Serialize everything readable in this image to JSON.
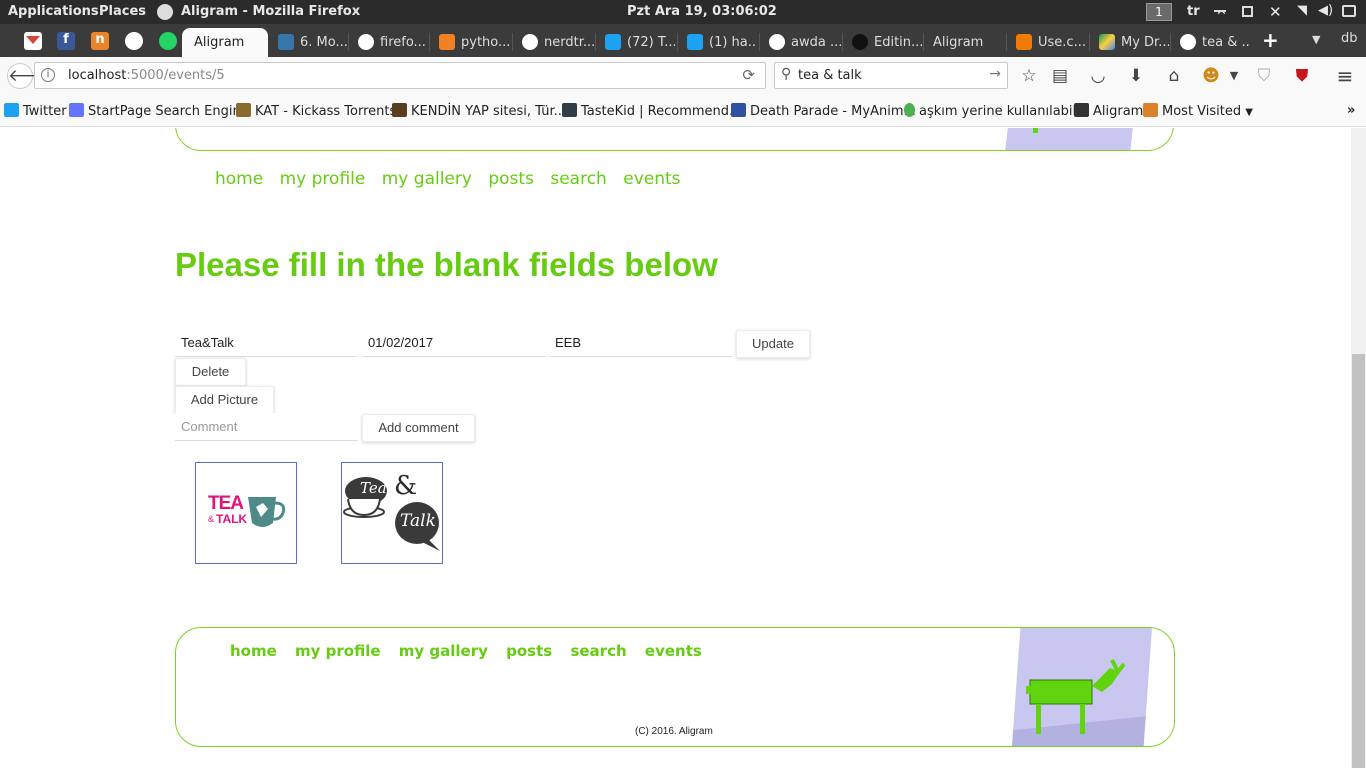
{
  "os": {
    "applications": "Applications",
    "places": "Places",
    "window_title": "Aligram - Mozilla Firefox",
    "clock": "Pzt Ara 19, 03:06:02",
    "workspace": "1",
    "keyboard_layout": "tr"
  },
  "tabs": [
    {
      "label": "Aligram",
      "active": true
    },
    {
      "label": "6. Mo..."
    },
    {
      "label": "firefo..."
    },
    {
      "label": "pytho..."
    },
    {
      "label": "nerdtr..."
    },
    {
      "label": "(72) T..."
    },
    {
      "label": "(1) ha..."
    },
    {
      "label": "awda ..."
    },
    {
      "label": "Editin..."
    },
    {
      "label": "Aligram"
    },
    {
      "label": "Use.c..."
    },
    {
      "label": "My Dr..."
    },
    {
      "label": "tea & ..."
    }
  ],
  "tab_overflow_label": "db",
  "nav": {
    "url_host": "localhost",
    "url_rest": ":5000/events/5",
    "search_text": "tea & talk"
  },
  "bookmarks": [
    {
      "label": "Twitter",
      "color": "#1da1f2"
    },
    {
      "label": "StartPage Search Engine",
      "color": "#6573ff"
    },
    {
      "label": "KAT - Kickass Torrents",
      "color": "#8a6b2e"
    },
    {
      "label": "KENDİN YAP sitesi, Tür...",
      "color": "#5a3d1e"
    },
    {
      "label": "TasteKid | Recommend...",
      "color": "#2f3e46"
    },
    {
      "label": "Death Parade - MyAnim...",
      "color": "#2e51a2"
    },
    {
      "label": "aşkım yerine kullanılabil...",
      "color": "#4caf50"
    },
    {
      "label": "Aligram",
      "color": "#333333"
    },
    {
      "label": "Most Visited",
      "color": "#d9822b"
    }
  ],
  "site": {
    "accent": "#66cc11",
    "nav_links": [
      "home",
      "my profile",
      "my gallery",
      "posts",
      "search",
      "events"
    ],
    "page_title": "Please fill in the blank fields below",
    "form": {
      "event_name": "Tea&Talk",
      "event_date": "01/02/2017",
      "event_place": "EEB",
      "update_label": "Update",
      "delete_label": "Delete",
      "add_picture_label": "Add Picture",
      "comment_placeholder": "Comment",
      "add_comment_label": "Add comment"
    },
    "pictures": [
      {
        "logo_line1": "TEA",
        "logo_amp": "&",
        "logo_line2": "TALK"
      },
      {
        "logo_line1": "Tea",
        "logo_amp": "&",
        "logo_line2": "Talk"
      }
    ],
    "footer_copyright": "(C) 2016. Aligram"
  }
}
